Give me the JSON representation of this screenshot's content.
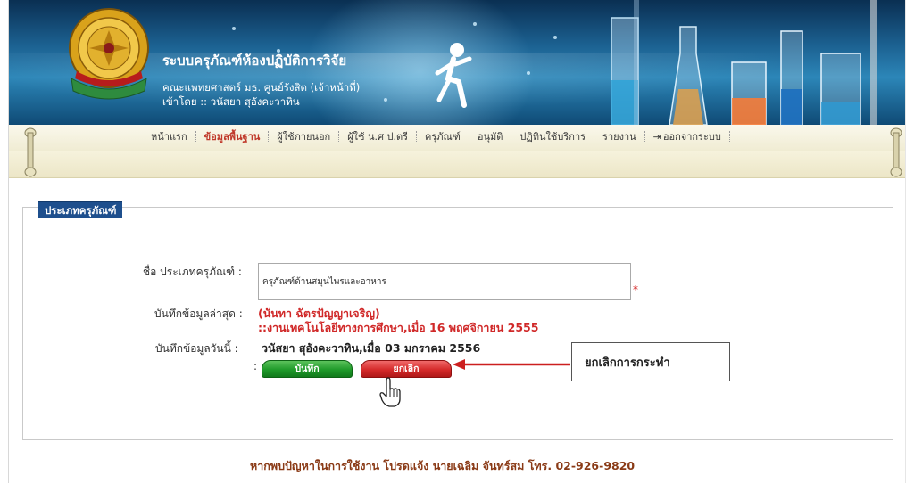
{
  "site": {
    "title": "ระบบครุภัณฑ์ห้องปฏิบัติการวิจัย",
    "faculty": "คณะแพทยศาสตร์ มธ. ศูนย์รังสิต (เจ้าหน้าที่)",
    "login_as": "เข้าโดย :: วนัสยา สุอังคะวาทิน"
  },
  "menu": [
    {
      "label": "หน้าแรก",
      "active": false
    },
    {
      "label": "ข้อมูลพื้นฐาน",
      "active": true
    },
    {
      "label": "ผู้ใช้ภายนอก",
      "active": false
    },
    {
      "label": "ผู้ใช้ น.ศ ป.ตรี",
      "active": false
    },
    {
      "label": "ครุภัณฑ์",
      "active": false
    },
    {
      "label": "อนุมัติ",
      "active": false
    },
    {
      "label": "ปฏิทินใช้บริการ",
      "active": false
    },
    {
      "label": "รายงาน",
      "active": false
    },
    {
      "label": "ออกจากระบบ",
      "active": false
    }
  ],
  "panel": {
    "title": "ประเภทครุภัณฑ์"
  },
  "form": {
    "name_label": "ชื่อ ประเภทครุภัณฑ์ :",
    "name_value": "ครุภัณฑ์ด้านสมุนไพรและอาหาร",
    "required_mark": "*",
    "last_saved_label": "บันทึกข้อมูลล่าสุด :",
    "last_saved_line1": "(นันทา ฉัตรปัญญาเจริญ)",
    "last_saved_line2": "::งานเทคโนโลยีทางการศึกษา,เมื่อ 16 พฤศจิกายน 2555",
    "today_label": "บันทึกข้อมูลวันนี้ :",
    "today_value": "วนัสยา สุอังคะวาทิน,เมื่อ 03 มกราคม 2556",
    "buttons_colon": ":",
    "save_label": "บันทึก",
    "cancel_label": "ยกเลิก"
  },
  "callout": {
    "text": "ยกเลิกการกระทำ"
  },
  "footer": {
    "text": "หากพบปัญหาในการใช้งาน โปรดแจ้ง นายเฉลิม จันทร์สม โทร. 02-926-9820"
  },
  "colors": {
    "panel_title_bg": "#1e4f8d",
    "active_menu": "#c0392b",
    "save_button": "#1f9a2a",
    "cancel_button": "#d52a2a",
    "footer_text": "#8a3a16"
  }
}
